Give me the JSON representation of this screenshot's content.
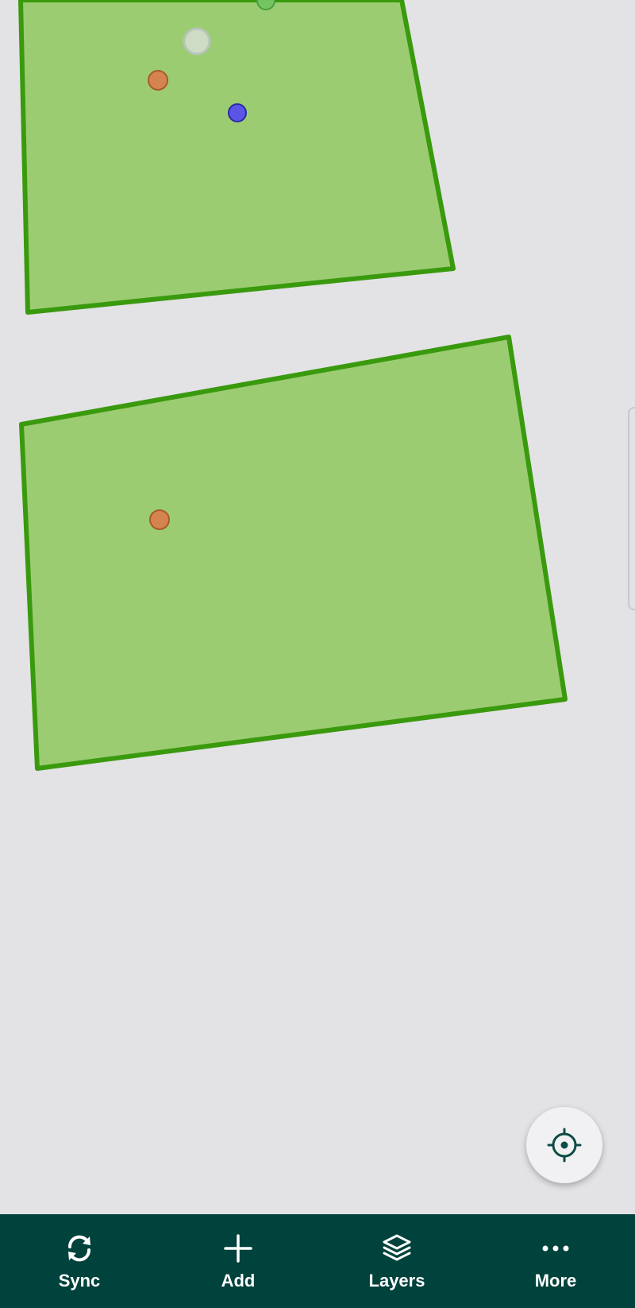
{
  "map": {
    "fill_color": "#9ccc72",
    "stroke_color": "#3a9a0e",
    "markers": [
      {
        "color": "orange",
        "hex": "#d6844f"
      },
      {
        "color": "blue",
        "hex": "#5b55e6"
      },
      {
        "color": "green",
        "hex": "#74c460"
      },
      {
        "color": "light-gray",
        "hex": "#cfdcc5"
      }
    ]
  },
  "locate_button": {
    "icon": "crosshair-icon"
  },
  "nav": {
    "background": "#00423c",
    "items": [
      {
        "label": "Sync",
        "icon": "sync-icon"
      },
      {
        "label": "Add",
        "icon": "plus-icon"
      },
      {
        "label": "Layers",
        "icon": "layers-icon"
      },
      {
        "label": "More",
        "icon": "more-icon"
      }
    ]
  }
}
